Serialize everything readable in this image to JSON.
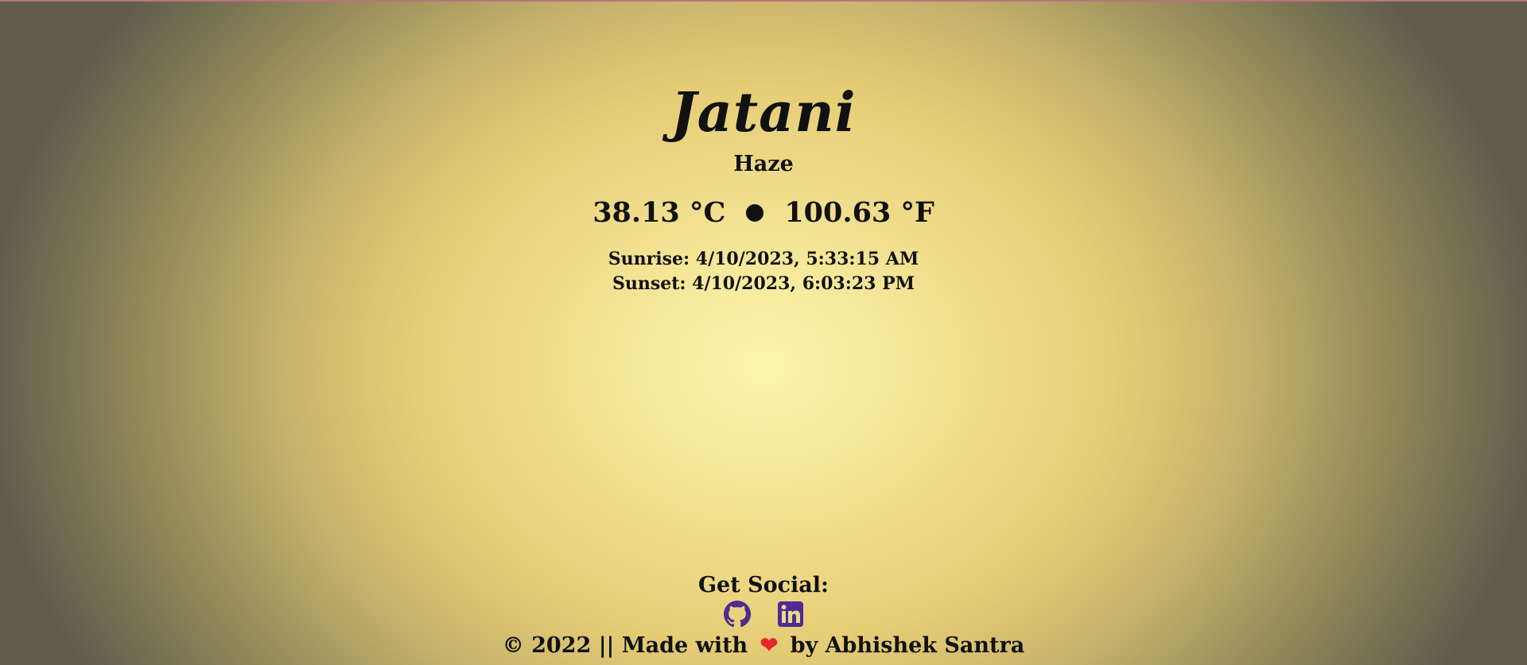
{
  "weather": {
    "city": "Jatani",
    "condition": "Haze",
    "temp_c": "38.13 °C",
    "temp_f": "100.63 °F",
    "sunrise": "Sunrise: 4/10/2023, 5:33:15 AM",
    "sunset": "Sunset: 4/10/2023, 6:03:23 PM"
  },
  "footer": {
    "social_title": "Get Social:",
    "icons": [
      "github-icon",
      "linkedin-icon"
    ],
    "copyright_prefix": "© 2022 || Made with",
    "heart": "❤",
    "copyright_suffix": "by Abhishek Santra"
  },
  "colors": {
    "icon": "#4f2a93",
    "heart": "#e8272c",
    "top_border": "#b9737e"
  }
}
